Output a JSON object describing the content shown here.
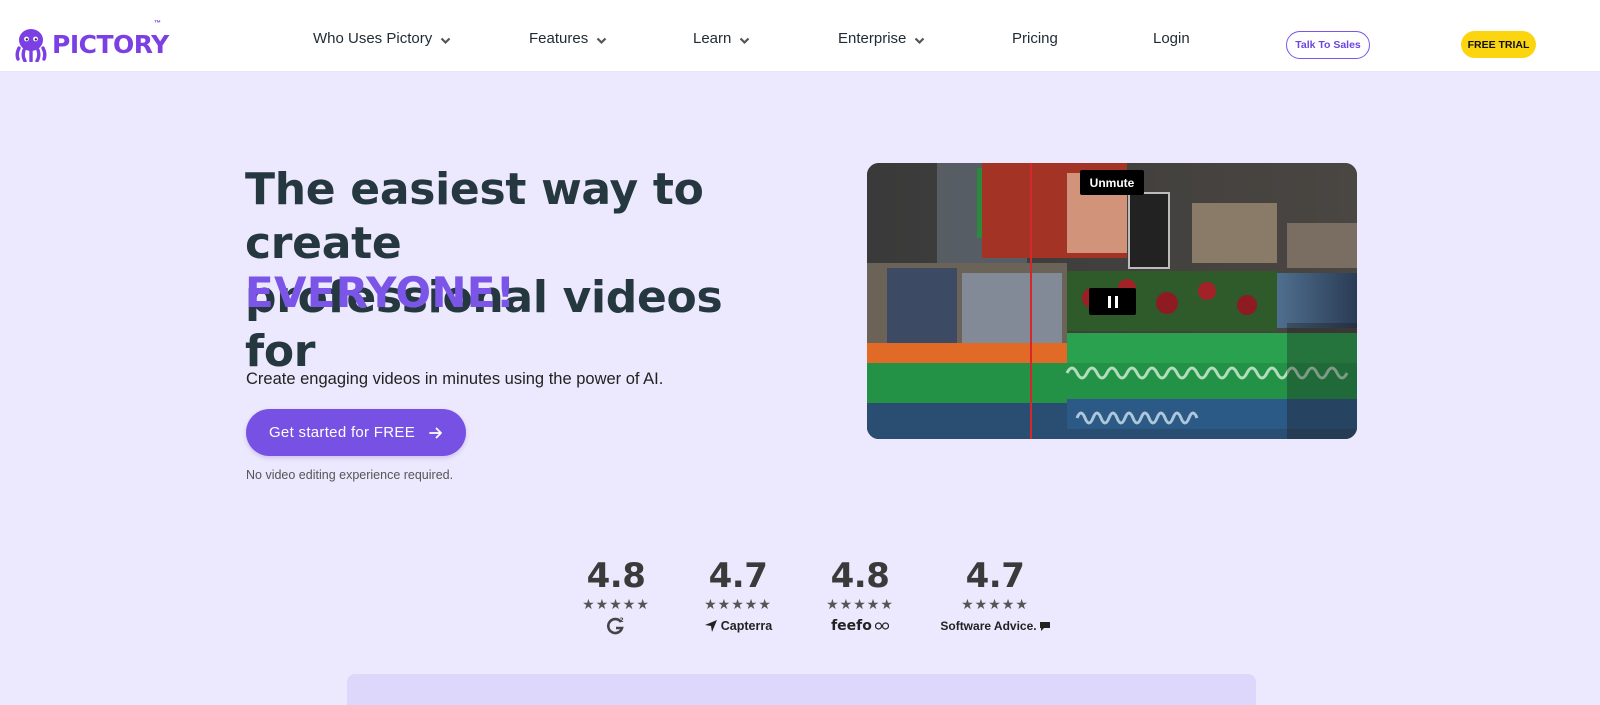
{
  "brand": {
    "name": "PICTORY",
    "tm": "™",
    "accent_color": "#7b55e8"
  },
  "nav": {
    "items": [
      {
        "label": "Who Uses Pictory",
        "has_dropdown": true
      },
      {
        "label": "Features",
        "has_dropdown": true
      },
      {
        "label": "Learn",
        "has_dropdown": true
      },
      {
        "label": "Enterprise",
        "has_dropdown": true
      },
      {
        "label": "Pricing",
        "has_dropdown": false
      },
      {
        "label": "Login",
        "has_dropdown": false
      }
    ],
    "talk_to_sales": "Talk To Sales",
    "free_trial": "FREE TRIAL",
    "free_trial_color": "#fcd511"
  },
  "hero": {
    "title_line1": "The easiest way to create",
    "title_line2": "professional videos for",
    "title_accent": "EVERYONE!",
    "subtitle": "Create engaging videos in minutes using the power of AI.",
    "cta_label": "Get started for FREE",
    "cta_icon": "arrow-right-icon",
    "note": "No video editing experience required."
  },
  "video": {
    "unmute_label": "Unmute",
    "state": "playing",
    "clip_label": "042300111.mov"
  },
  "ratings": [
    {
      "score": "4.8",
      "stars": "★★★★★",
      "source": "G2"
    },
    {
      "score": "4.7",
      "stars": "★★★★★",
      "source": "Capterra"
    },
    {
      "score": "4.8",
      "stars": "★★★★★",
      "source": "feefo"
    },
    {
      "score": "4.7",
      "stars": "★★★★★",
      "source": "Software Advice."
    }
  ]
}
